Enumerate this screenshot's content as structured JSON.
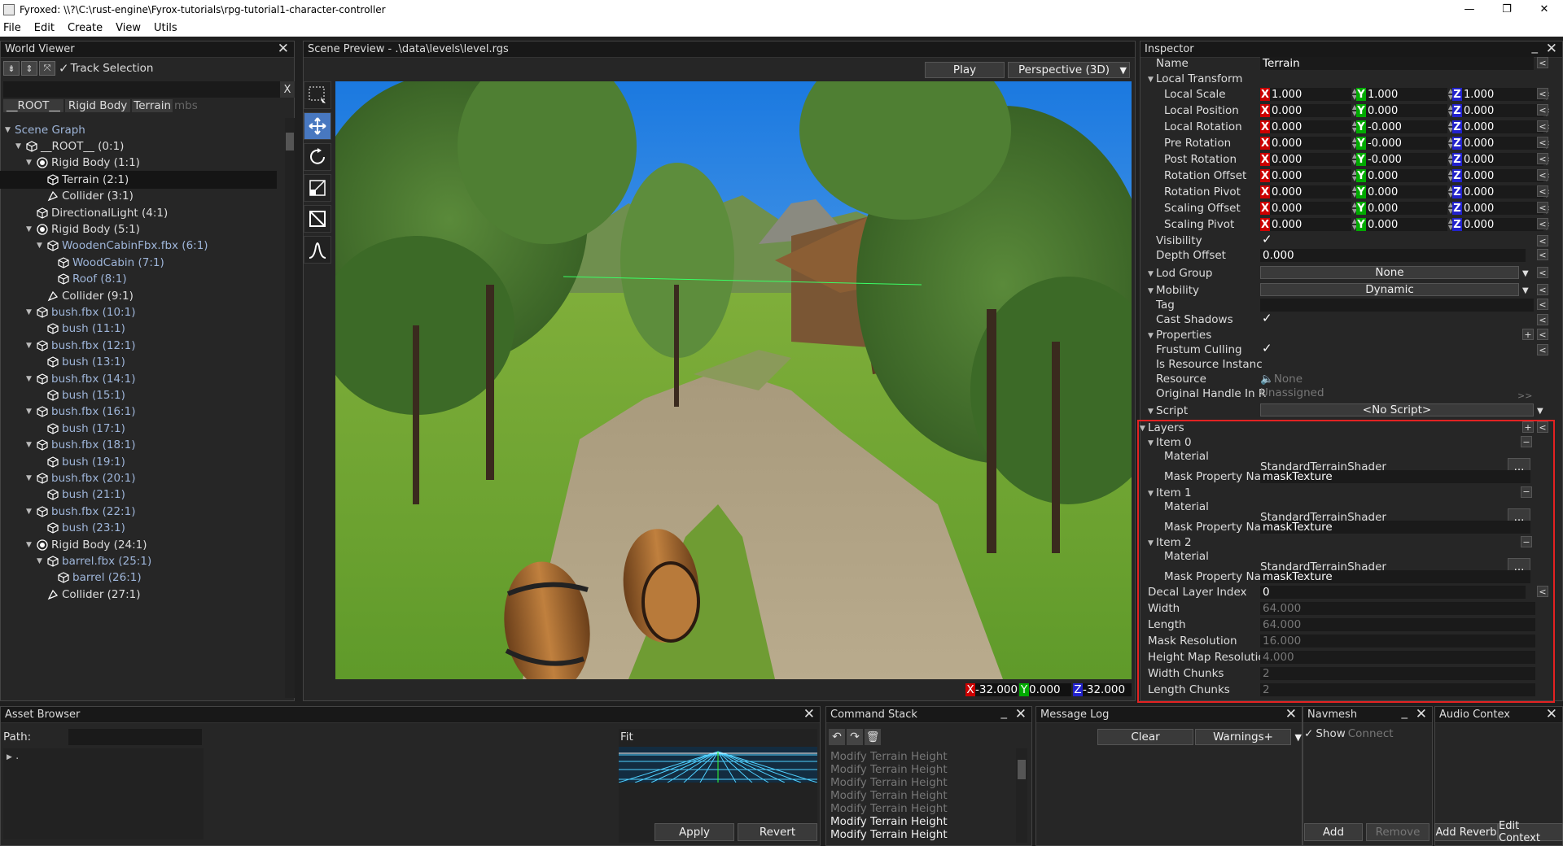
{
  "window": {
    "title": "Fyroxed: \\\\?\\C:\\rust-engine\\Fyrox-tutorials\\rpg-tutorial1-character-controller",
    "min": "—",
    "max": "❐",
    "close": "✕"
  },
  "menu": [
    "File",
    "Edit",
    "Create",
    "View",
    "Utils"
  ],
  "world_viewer": {
    "title": "World Viewer",
    "track_label": "Track Selection",
    "search_clear": "X",
    "breadcrumbs": [
      "__ROOT__",
      "Rigid Body",
      "Terrain"
    ],
    "breadcrumb_hint": "mbs",
    "scene_graph": "Scene Graph",
    "nodes": [
      {
        "label": "__ROOT__ (0:1)",
        "depth": 1,
        "arrow": true,
        "icon": "cube",
        "color": "w"
      },
      {
        "label": "Rigid Body (1:1)",
        "depth": 2,
        "arrow": true,
        "icon": "rb",
        "color": "w"
      },
      {
        "label": "Terrain (2:1)",
        "depth": 3,
        "arrow": false,
        "icon": "cube",
        "color": "w",
        "sel": true
      },
      {
        "label": "Collider (3:1)",
        "depth": 3,
        "arrow": false,
        "icon": "col",
        "color": "w"
      },
      {
        "label": "DirectionalLight (4:1)",
        "depth": 2,
        "arrow": false,
        "icon": "cube",
        "color": "w"
      },
      {
        "label": "Rigid Body (5:1)",
        "depth": 2,
        "arrow": true,
        "icon": "rb",
        "color": "w"
      },
      {
        "label": "WoodenCabinFbx.fbx (6:1)",
        "depth": 3,
        "arrow": true,
        "icon": "cube",
        "color": "b"
      },
      {
        "label": "WoodCabin (7:1)",
        "depth": 4,
        "arrow": false,
        "icon": "cube",
        "color": "b"
      },
      {
        "label": "Roof (8:1)",
        "depth": 4,
        "arrow": false,
        "icon": "cube",
        "color": "b"
      },
      {
        "label": "Collider (9:1)",
        "depth": 3,
        "arrow": false,
        "icon": "col",
        "color": "w"
      },
      {
        "label": "bush.fbx (10:1)",
        "depth": 2,
        "arrow": true,
        "icon": "cube",
        "color": "b"
      },
      {
        "label": "bush (11:1)",
        "depth": 3,
        "arrow": false,
        "icon": "cube",
        "color": "b"
      },
      {
        "label": "bush.fbx (12:1)",
        "depth": 2,
        "arrow": true,
        "icon": "cube",
        "color": "b"
      },
      {
        "label": "bush (13:1)",
        "depth": 3,
        "arrow": false,
        "icon": "cube",
        "color": "b"
      },
      {
        "label": "bush.fbx (14:1)",
        "depth": 2,
        "arrow": true,
        "icon": "cube",
        "color": "b"
      },
      {
        "label": "bush (15:1)",
        "depth": 3,
        "arrow": false,
        "icon": "cube",
        "color": "b"
      },
      {
        "label": "bush.fbx (16:1)",
        "depth": 2,
        "arrow": true,
        "icon": "cube",
        "color": "b"
      },
      {
        "label": "bush (17:1)",
        "depth": 3,
        "arrow": false,
        "icon": "cube",
        "color": "b"
      },
      {
        "label": "bush.fbx (18:1)",
        "depth": 2,
        "arrow": true,
        "icon": "cube",
        "color": "b"
      },
      {
        "label": "bush (19:1)",
        "depth": 3,
        "arrow": false,
        "icon": "cube",
        "color": "b"
      },
      {
        "label": "bush.fbx (20:1)",
        "depth": 2,
        "arrow": true,
        "icon": "cube",
        "color": "b"
      },
      {
        "label": "bush (21:1)",
        "depth": 3,
        "arrow": false,
        "icon": "cube",
        "color": "b"
      },
      {
        "label": "bush.fbx (22:1)",
        "depth": 2,
        "arrow": true,
        "icon": "cube",
        "color": "b"
      },
      {
        "label": "bush (23:1)",
        "depth": 3,
        "arrow": false,
        "icon": "cube",
        "color": "b"
      },
      {
        "label": "Rigid Body (24:1)",
        "depth": 2,
        "arrow": true,
        "icon": "rb",
        "color": "w"
      },
      {
        "label": "barrel.fbx (25:1)",
        "depth": 3,
        "arrow": true,
        "icon": "cube",
        "color": "b"
      },
      {
        "label": "barrel (26:1)",
        "depth": 4,
        "arrow": false,
        "icon": "cube",
        "color": "b"
      },
      {
        "label": "Collider (27:1)",
        "depth": 3,
        "arrow": false,
        "icon": "col",
        "color": "w"
      }
    ]
  },
  "scene_preview": {
    "title": "Scene Preview - .\\data\\levels\\level.rgs",
    "play": "Play",
    "camera_mode": "Perspective (3D)",
    "coords": {
      "x_label": "X",
      "x": "-32.000",
      "y_label": "Y",
      "y": "0.000",
      "z_label": "Z",
      "z": "-32.000"
    }
  },
  "inspector": {
    "title": "Inspector",
    "name_label": "Name",
    "name_value": "Terrain",
    "local_transform": "Local Transform",
    "vectors": [
      {
        "label": "Local Scale",
        "x": "1.000",
        "y": "1.000",
        "z": "1.000"
      },
      {
        "label": "Local Position",
        "x": "0.000",
        "y": "0.000",
        "z": "0.000"
      },
      {
        "label": "Local Rotation",
        "x": "0.000",
        "y": "-0.000",
        "z": "0.000"
      },
      {
        "label": "Pre Rotation",
        "x": "0.000",
        "y": "-0.000",
        "z": "0.000"
      },
      {
        "label": "Post Rotation",
        "x": "0.000",
        "y": "-0.000",
        "z": "0.000"
      },
      {
        "label": "Rotation Offset",
        "x": "0.000",
        "y": "0.000",
        "z": "0.000"
      },
      {
        "label": "Rotation Pivot",
        "x": "0.000",
        "y": "0.000",
        "z": "0.000"
      },
      {
        "label": "Scaling Offset",
        "x": "0.000",
        "y": "0.000",
        "z": "0.000"
      },
      {
        "label": "Scaling Pivot",
        "x": "0.000",
        "y": "0.000",
        "z": "0.000"
      }
    ],
    "axis": {
      "x": "X",
      "y": "Y",
      "z": "Z"
    },
    "visibility": "Visibility",
    "depth_offset": "Depth Offset",
    "depth_offset_value": "0.000",
    "lod_group": "Lod Group",
    "lod_value": "None",
    "mobility": "Mobility",
    "mobility_value": "Dynamic",
    "tag": "Tag",
    "cast_shadows": "Cast Shadows",
    "properties": "Properties",
    "frustum": "Frustum Culling",
    "is_resource": "Is Resource Instanc",
    "resource": "Resource",
    "resource_value": "None",
    "original_handle": "Original Handle In R",
    "original_handle_value": "Unassigned",
    "script": "Script",
    "script_value": "<No Script>",
    "layers": "Layers",
    "items": [
      {
        "label": "Item 0",
        "material": "Material",
        "material_value": "StandardTerrainShader",
        "mask": "Mask Property Nai",
        "mask_value": "maskTexture"
      },
      {
        "label": "Item 1",
        "material": "Material",
        "material_value": "StandardTerrainShader",
        "mask": "Mask Property Nai",
        "mask_value": "maskTexture"
      },
      {
        "label": "Item 2",
        "material": "Material",
        "material_value": "StandardTerrainShader",
        "mask": "Mask Property Nai",
        "mask_value": "maskTexture"
      }
    ],
    "decal": "Decal Layer Index",
    "decal_value": "0",
    "width": "Width",
    "width_value": "64.000",
    "length": "Length",
    "length_value": "64.000",
    "mask_res": "Mask Resolution",
    "mask_res_value": "16.000",
    "height_res": "Height Map Resolutio",
    "height_res_value": "4.000",
    "width_chunks": "Width Chunks",
    "width_chunks_value": "2",
    "length_chunks": "Length Chunks",
    "length_chunks_value": "2",
    "ellipsis": "...",
    "plus": "+",
    "minus": "−",
    "back": "<",
    "fwd": ">>"
  },
  "asset_browser": {
    "title": "Asset Browser",
    "path_label": "Path:",
    "root": ".",
    "fit": "Fit",
    "apply": "Apply",
    "revert": "Revert"
  },
  "command_stack": {
    "title": "Command Stack",
    "items": [
      "Modify Terrain Height",
      "Modify Terrain Height",
      "Modify Terrain Height",
      "Modify Terrain Height",
      "Modify Terrain Height",
      "Modify Terrain Height",
      "Modify Terrain Height"
    ]
  },
  "message_log": {
    "title": "Message Log",
    "clear": "Clear",
    "filter": "Warnings+"
  },
  "navmesh": {
    "title": "Navmesh",
    "show": "Show",
    "connect": "Connect",
    "add": "Add",
    "remove": "Remove"
  },
  "audio": {
    "title": "Audio Contex",
    "add_reverb": "Add Reverb",
    "edit_context": "Edit Context"
  }
}
